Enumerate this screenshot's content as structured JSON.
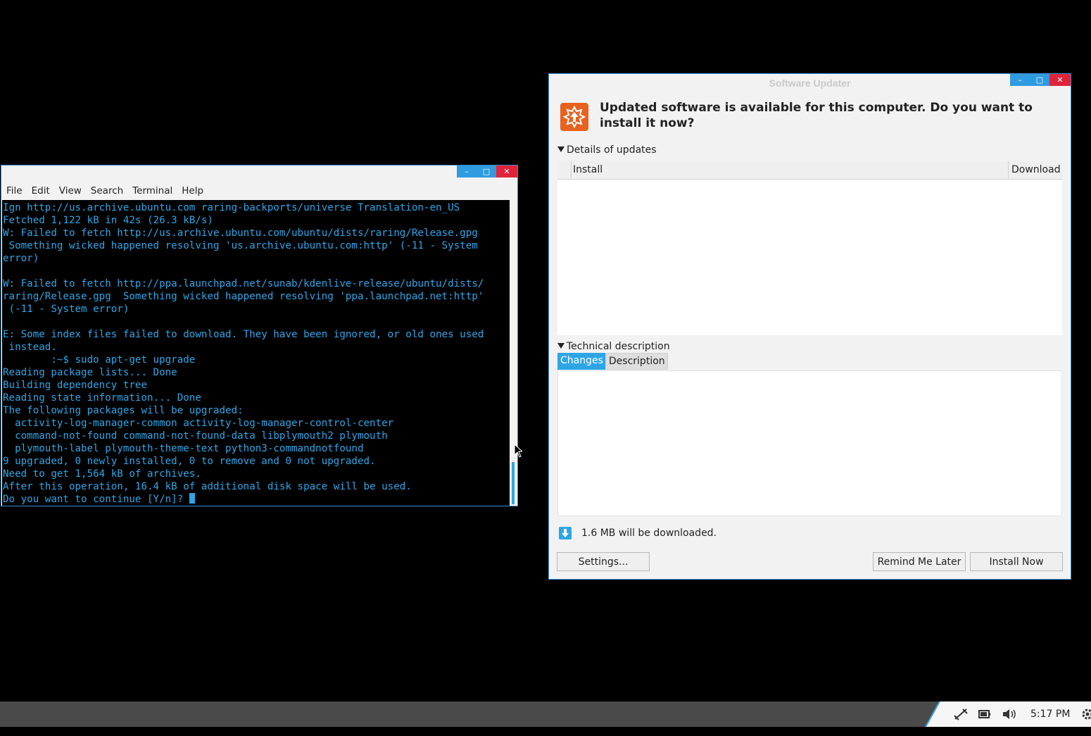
{
  "terminal": {
    "menu": [
      "File",
      "Edit",
      "View",
      "Search",
      "Terminal",
      "Help"
    ],
    "lines": [
      "Ign http://us.archive.ubuntu.com raring-backports/universe Translation-en_US",
      "Fetched 1,122 kB in 42s (26.3 kB/s)",
      "W: Failed to fetch http://us.archive.ubuntu.com/ubuntu/dists/raring/Release.gpg",
      " Something wicked happened resolving 'us.archive.ubuntu.com:http' (-11 - System",
      "error)",
      "",
      "W: Failed to fetch http://ppa.launchpad.net/sunab/kdenlive-release/ubuntu/dists/",
      "raring/Release.gpg  Something wicked happened resolving 'ppa.launchpad.net:http'",
      " (-11 - System error)",
      "",
      "E: Some index files failed to download. They have been ignored, or old ones used",
      " instead.",
      "        :~$ sudo apt-get upgrade",
      "Reading package lists... Done",
      "Building dependency tree",
      "Reading state information... Done",
      "The following packages will be upgraded:",
      "  activity-log-manager-common activity-log-manager-control-center",
      "  command-not-found command-not-found-data libplymouth2 plymouth",
      "  plymouth-label plymouth-theme-text python3-commandnotfound",
      "9 upgraded, 0 newly installed, 0 to remove and 0 not upgraded.",
      "Need to get 1,564 kB of archives.",
      "After this operation, 16.4 kB of additional disk space will be used."
    ],
    "prompt_line": "Do you want to continue [Y/n]? "
  },
  "updater": {
    "title": "Software Updater",
    "headline": "Updated software is available for this computer. Do you want to install it now?",
    "details_label": "Details of updates",
    "columns": {
      "install": "Install",
      "download": "Download"
    },
    "technical_label": "Technical description",
    "tabs": {
      "changes": "Changes",
      "description": "Description"
    },
    "download_info": "1.6 MB will be downloaded.",
    "buttons": {
      "settings": "Settings...",
      "remind": "Remind Me Later",
      "install": "Install Now"
    }
  },
  "taskbar": {
    "clock": "5:17 PM"
  },
  "colors": {
    "accent": "#2ea6e6",
    "close": "#e0233a",
    "updater_icon": "#e8621f"
  }
}
